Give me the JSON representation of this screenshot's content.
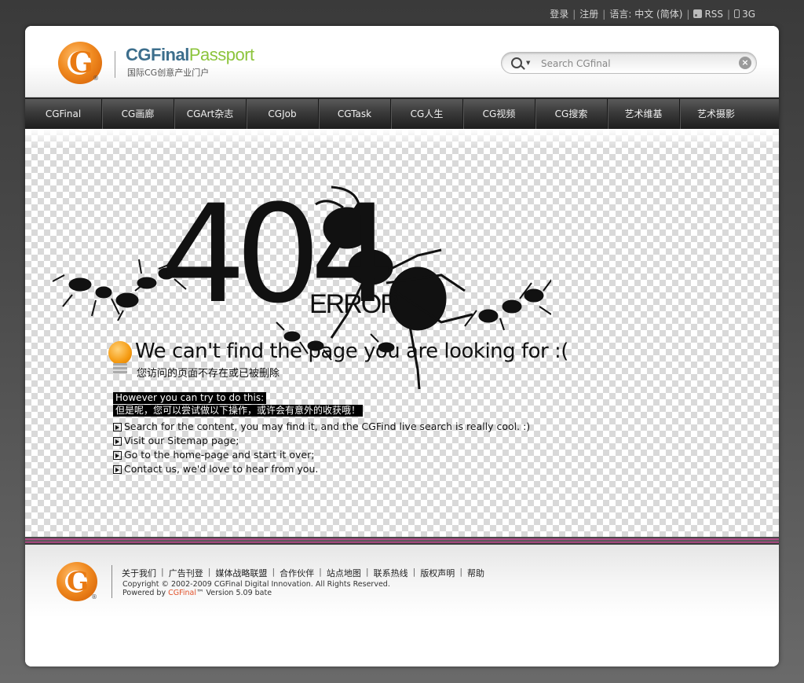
{
  "top_links": {
    "login": "登录",
    "register": "注册",
    "language": "语言: 中文 (简体)",
    "rss": "RSS",
    "mobile": "3G"
  },
  "header": {
    "brand_part1": "CGFinal",
    "brand_part2": "Passport",
    "brand_sub": "国际CG创意产业门户",
    "search_placeholder": "Search CGfinal",
    "clear_glyph": "×"
  },
  "nav": {
    "items": [
      {
        "label": "CGFinal"
      },
      {
        "label": "CG画廊"
      },
      {
        "label": "CGArt杂志"
      },
      {
        "label": "CGJob"
      },
      {
        "label": "CGTask"
      },
      {
        "label": "CG人生"
      },
      {
        "label": "CG视频"
      },
      {
        "label": "CG搜索"
      },
      {
        "label": "艺术维基"
      },
      {
        "label": "艺术摄影"
      }
    ]
  },
  "error": {
    "code": "404",
    "word": "ERROR",
    "headline": "We can't find the page you are looking for :(",
    "headline_cn": "您访问的页面不存在或已被删除",
    "try_en": "However you can try to do this:",
    "try_cn": "但是呢，您可以尝试做以下操作，或许会有意外的收获哦！",
    "tips": [
      "Search for the content, you may find it, and the CGFind live search is really cool. :)",
      "Visit our Sitemap page;",
      "Go to the home-page and start it over;",
      "Contact us, we'd love to hear from you."
    ]
  },
  "footer": {
    "links": [
      "关于我们",
      "广告刊登",
      "媒体战略联盟",
      "合作伙伴",
      "站点地图",
      "联系热线",
      "版权声明",
      "帮助"
    ],
    "copyright": "Copyright © 2002-2009 CGFinal Digital Innovation. All Rights Reserved.",
    "powered_prefix": "Powered by ",
    "powered_brand": "CGFinal",
    "powered_suffix": "™ Version 5.09 bate"
  },
  "colors": {
    "brand_blue": "#3c6e8c",
    "brand_green": "#8cc43c",
    "logo_orange": "#f08a20",
    "stripe_magenta": "#b04a86"
  }
}
